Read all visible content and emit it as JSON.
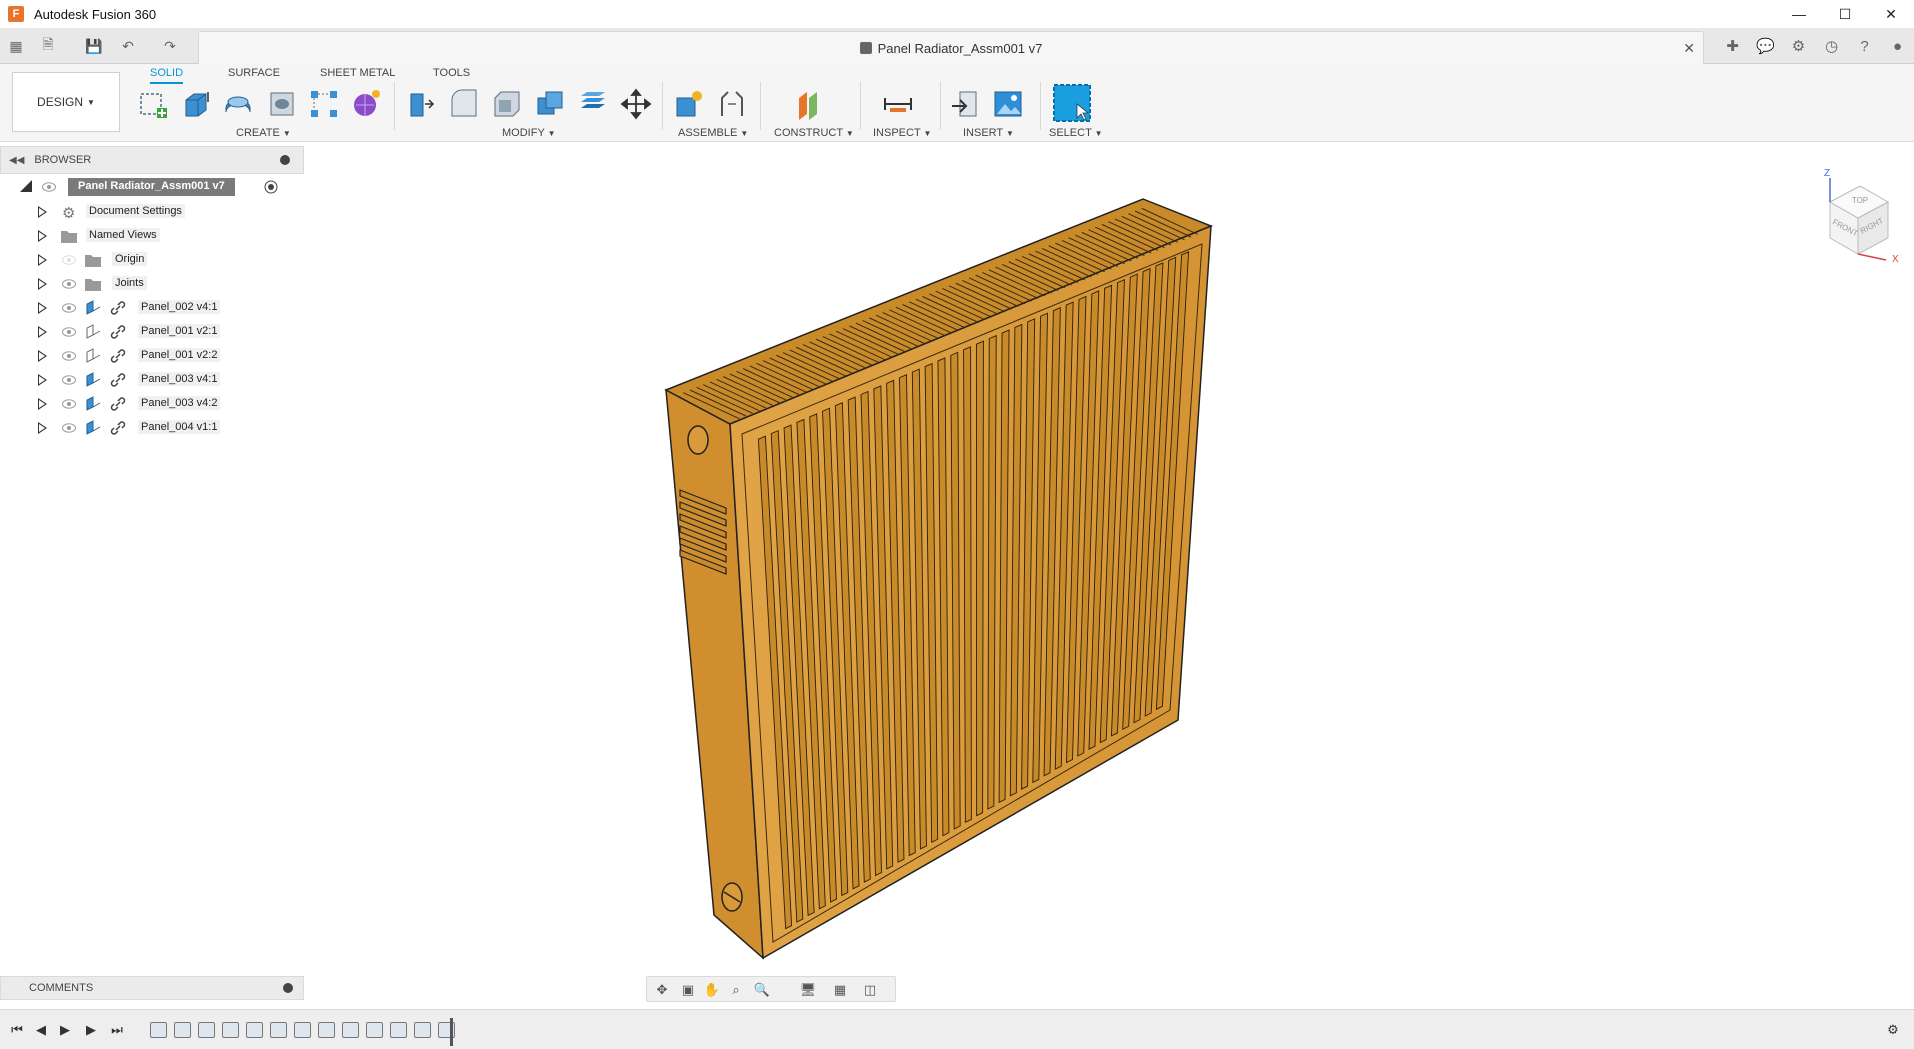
{
  "titlebar": {
    "app_icon_letter": "F",
    "title": "Autodesk Fusion 360",
    "controls": [
      "minimize-icon",
      "maximize-icon",
      "close-icon"
    ]
  },
  "document": {
    "title": "Panel Radiator_Assm001 v7"
  },
  "toolbar": {
    "workspace": "DESIGN",
    "tabs": [
      "SOLID",
      "SURFACE",
      "SHEET METAL",
      "TOOLS"
    ],
    "active_tab": "SOLID",
    "groups": [
      "CREATE",
      "MODIFY",
      "ASSEMBLE",
      "CONSTRUCT",
      "INSPECT",
      "INSERT",
      "SELECT"
    ]
  },
  "browser": {
    "title": "BROWSER",
    "root": "Panel Radiator_Assm001 v7",
    "items": [
      {
        "label": "Document Settings",
        "icon": "gear-icon"
      },
      {
        "label": "Named Views",
        "icon": "folder-icon"
      },
      {
        "label": "Origin",
        "icon": "folder-icon"
      },
      {
        "label": "Joints",
        "icon": "folder-icon"
      },
      {
        "label": "Panel_002 v4:1",
        "icon": "component-icon"
      },
      {
        "label": "Panel_001 v2:1",
        "icon": "component-icon"
      },
      {
        "label": "Panel_001 v2:2",
        "icon": "component-icon"
      },
      {
        "label": "Panel_003 v4:1",
        "icon": "component-icon"
      },
      {
        "label": "Panel_003 v4:2",
        "icon": "component-icon"
      },
      {
        "label": "Panel_004 v1:1",
        "icon": "component-icon"
      }
    ]
  },
  "comments": {
    "title": "COMMENTS"
  },
  "viewcube": {
    "faces": [
      "TOP",
      "FRONT",
      "RIGHT"
    ],
    "axes": [
      "Z",
      "X"
    ]
  },
  "colors": {
    "accent": "#0696d7",
    "model": "#d99a3a",
    "model_dark": "#b97a22"
  }
}
